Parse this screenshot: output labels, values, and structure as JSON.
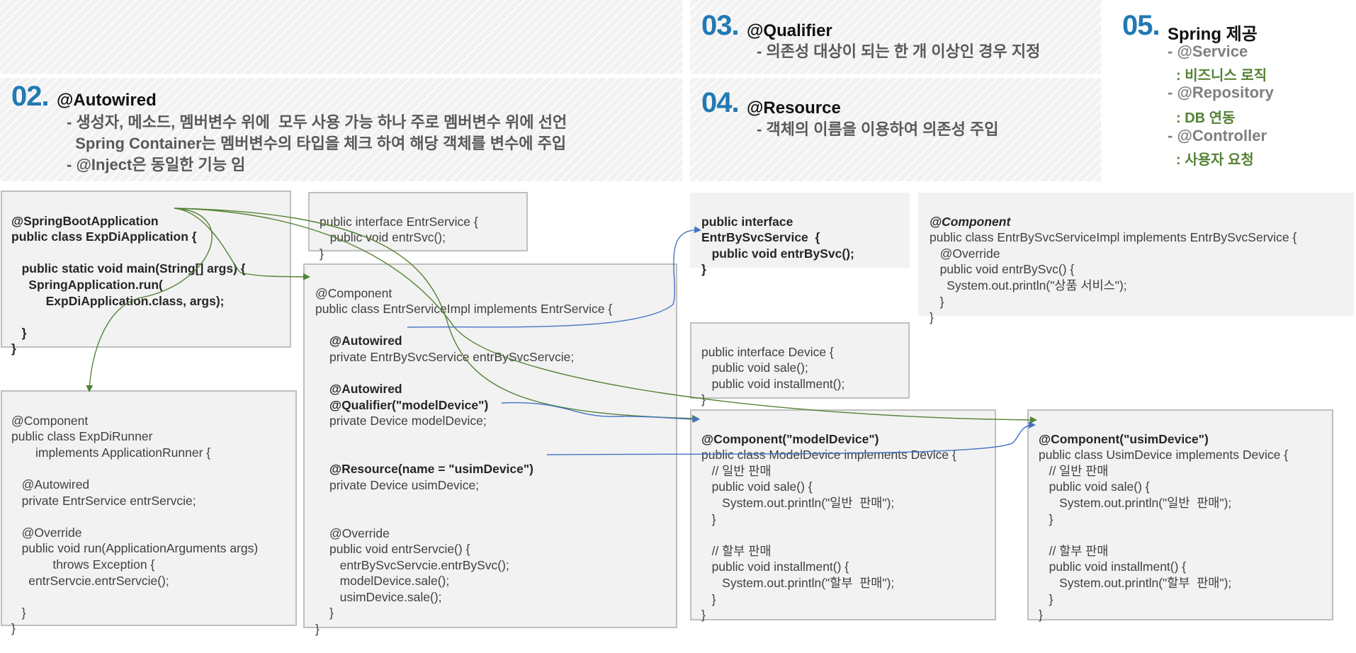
{
  "sections": {
    "s02": {
      "num": "02.",
      "title": "@Autowired",
      "lines": [
        "- 생성자, 메소드, 멤버변수 위에  모두 사용 가능 하나 주로 멤버변수 위에 선언",
        "  Spring Container는 멤버변수의 타입을 체크 하여 해당 객체를 변수에 주입",
        "- @Inject은 동일한 기능 임"
      ]
    },
    "s03": {
      "num": "03.",
      "title": "@Qualifier",
      "lines": [
        "- 의존성 대상이 되는 한 개 이상인 경우 지정"
      ]
    },
    "s04": {
      "num": "04.",
      "title": "@Resource",
      "lines": [
        "- 객체의 이름을 이용하여 의존성 주입"
      ]
    },
    "s05": {
      "num": "05.",
      "title": "Spring 제공",
      "items": [
        {
          "name": "- @Service",
          "desc": ": 비즈니스 로직"
        },
        {
          "name": "- @Repository",
          "desc": ": DB 연동"
        },
        {
          "name": "- @Controller",
          "desc": ": 사용자 요청"
        }
      ]
    }
  },
  "code": {
    "app": [
      "@SpringBootApplication",
      "public class ExpDiApplication {",
      "",
      "   public static void main(String[] args) {",
      "     SpringApplication.run(",
      "          ExpDiApplication.class, args);",
      "",
      "   }",
      "}"
    ],
    "runner": [
      "@Component",
      "public class ExpDiRunner",
      "       implements ApplicationRunner {",
      "",
      "   @Autowired",
      "   private EntrService entrServcie;",
      "",
      "   @Override",
      "   public void run(ApplicationArguments args)",
      "            throws Exception {",
      "     entrServcie.entrServcie();",
      "",
      "   }",
      "}"
    ],
    "entr_iface": [
      "public interface EntrService {",
      "   public void entrSvc();",
      "}"
    ],
    "entr_impl": {
      "head": [
        "@Component",
        "public class EntrServiceImpl implements EntrService {"
      ],
      "autowired1": "@Autowired",
      "field1": "private EntrBySvcService entrBySvcServcie;",
      "autowired2": "@Autowired",
      "qualifier": "@Qualifier(\"modelDevice\")",
      "field2": "private Device modelDevice;",
      "resource": "@Resource(name = \"usimDevice\")",
      "field3": "private Device usimDevice;",
      "tail": [
        "@Override",
        "public void entrServcie() {",
        "   entrBySvcServcie.entrBySvc();",
        "   modelDevice.sale();",
        "   usimDevice.sale();",
        "}"
      ],
      "close": "}"
    },
    "bysvc_iface": [
      "public interface",
      "EntrBySvcService  {",
      "   public void entrBySvc();",
      "}"
    ],
    "bysvc_impl": {
      "annot": "@Component",
      "lines": [
        "public class EntrBySvcServiceImpl implements EntrBySvcService {",
        "   @Override",
        "   public void entrBySvc() {",
        "     System.out.println(\"상품 서비스\");",
        "   }",
        "}"
      ]
    },
    "device_iface": [
      "public interface Device {",
      "   public void sale();",
      "   public void installment();",
      "}"
    ],
    "model_device": {
      "annot": "@Component(\"modelDevice\")",
      "lines": [
        "public class ModelDevice implements Device {",
        "   // 일반 판매",
        "   public void sale() {",
        "      System.out.println(\"일반  판매\");",
        "   }",
        "",
        "   // 할부 판매",
        "   public void installment() {",
        "      System.out.println(\"할부  판매\");",
        "   }",
        "}"
      ]
    },
    "usim_device": {
      "annot": "@Component(\"usimDevice\")",
      "lines": [
        "public class UsimDevice implements Device {",
        "   // 일반 판매",
        "   public void sale() {",
        "      System.out.println(\"일반  판매\");",
        "   }",
        "",
        "   // 할부 판매",
        "   public void installment() {",
        "      System.out.println(\"할부  판매\");",
        "   }",
        "}"
      ]
    }
  },
  "colors": {
    "accent_number": "#2179b5",
    "green_arrow": "#548235",
    "blue_arrow": "#4472c4",
    "box_fill": "#f2f2f2",
    "box_border": "#bfbfbf"
  }
}
